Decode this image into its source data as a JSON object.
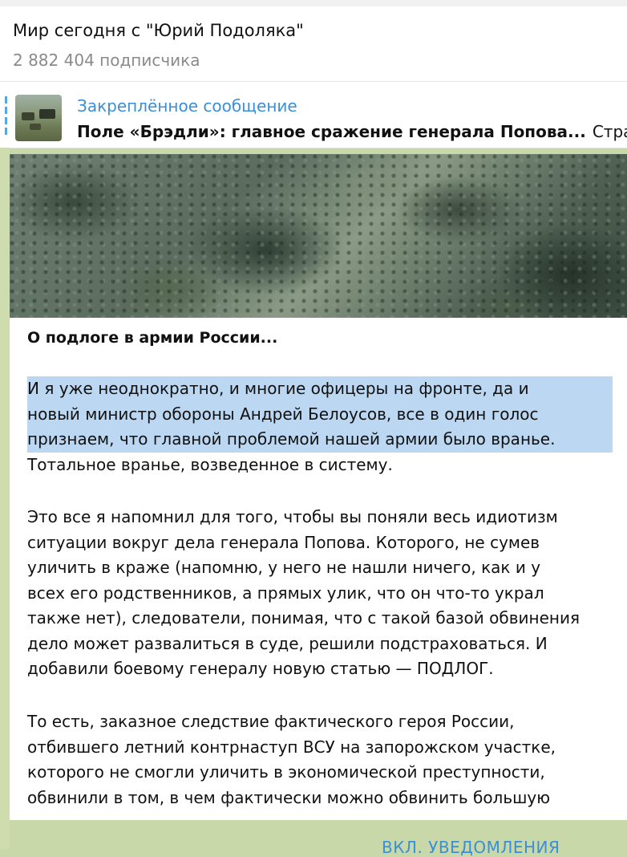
{
  "header": {
    "title": "Мир сегодня с \"Юрий Подоляка\"",
    "subscribers": "2 882 404 подписчика"
  },
  "pinned": {
    "title": "Закреплённое сообщение",
    "text": "Поле «Брэдли»: главное сражение генерала Попова...",
    "text_extra": "Стра"
  },
  "message": {
    "heading": "О подлоге в армии России...",
    "paragraph1": [
      "И я уже неоднократно, и многие офицеры на фронте, да и",
      "новый министр обороны Андрей Белоусов, все в один голос",
      "признаем, что главной проблемой нашей армии было вранье.",
      "Тотальное вранье, возведенное в систему."
    ],
    "paragraph2": [
      "Это все я напомнил для того, чтобы вы поняли весь идиотизм",
      "ситуации вокруг дела генерала Попова. Которого, не сумев",
      "уличить в краже (напомню, у него не нашли ничего, как и у",
      "всех его родственников, а прямых улик, что он что-то украл",
      "также нет), следователи, понимая, что с такой базой обвинения",
      "дело может развалиться в суде, решили подстраховаться. И",
      "добавили боевому генералу новую статью — ПОДЛОГ."
    ],
    "paragraph3": [
      "То есть, заказное следствие фактического героя России,",
      "отбившего летний контрнаступ ВСУ на запорожском участке,",
      "которого не смогли уличить в экономической преступности,",
      "обвинили в том, в чем фактически можно обвинить большую"
    ]
  },
  "footer": {
    "button": "ВКЛ. УВЕДОМЛЕНИЯ"
  },
  "colors": {
    "accent": "#3a8fd6",
    "highlight": "#bcd7f2",
    "chat_background": "#c9d8a8"
  }
}
